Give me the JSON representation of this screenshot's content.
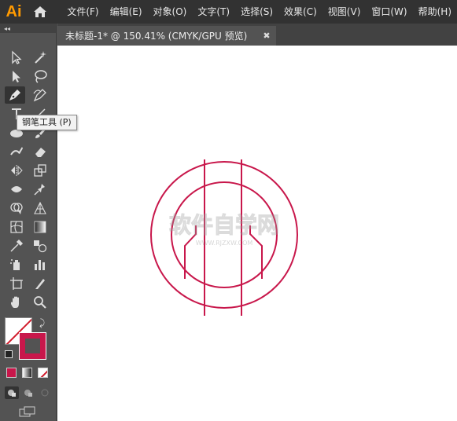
{
  "app": {
    "logo_text": "Ai",
    "home_icon": "home-icon"
  },
  "menu": [
    "文件(F)",
    "编辑(E)",
    "对象(O)",
    "文字(T)",
    "选择(S)",
    "效果(C)",
    "视图(V)",
    "窗口(W)",
    "帮助(H)"
  ],
  "tab": {
    "title": "未标题-1* @ 150.41% (CMYK/GPU 预览)",
    "close": "✖"
  },
  "toolbar": {
    "collapse_glyph": "◂◂"
  },
  "tooltip": {
    "text": "钢笔工具 (P)"
  },
  "colors": {
    "stroke": "#c8174b",
    "accent": "#ff9a00",
    "panel": "#535353",
    "menubar": "#323232"
  },
  "watermark": {
    "main": "软件自学网",
    "sub": "WWW.RJZXW.COM"
  },
  "tools": [
    "selection-tool",
    "direct-selection-tool",
    "magic-wand-tool",
    "lasso-tool",
    "pen-tool",
    "curvature-tool",
    "type-tool",
    "line-tool",
    "ellipse-tool",
    "paintbrush-tool",
    "shaper-tool",
    "eraser-tool",
    "rotate-tool",
    "scale-tool",
    "width-tool",
    "puppet-warp-tool",
    "shape-builder-tool",
    "perspective-grid-tool",
    "mesh-tool",
    "gradient-tool",
    "eyedropper-tool",
    "blend-tool",
    "symbol-sprayer-tool",
    "column-graph-tool",
    "artboard-tool",
    "slice-tool",
    "hand-tool",
    "zoom-tool"
  ]
}
